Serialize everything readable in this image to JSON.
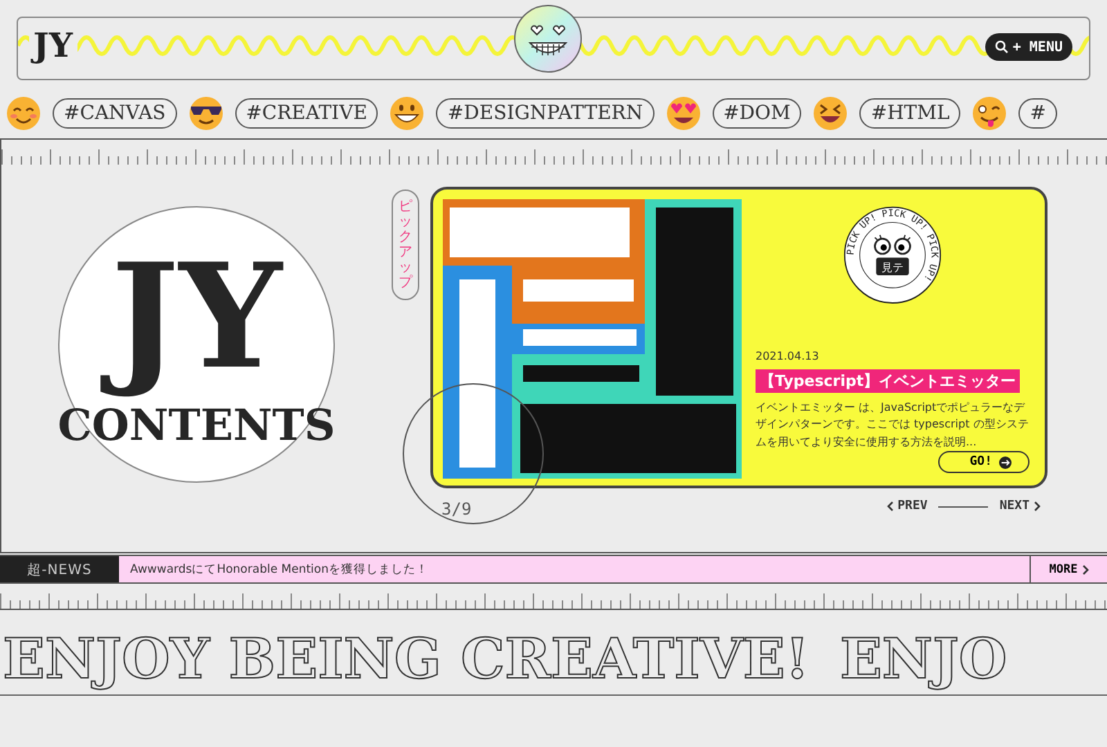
{
  "header": {
    "logo": "JY",
    "menu_button": "+ MENU"
  },
  "tags": [
    "#CANVAS",
    "#CREATIVE",
    "#DESIGNPATTERN",
    "#DOM",
    "#HTML",
    "#"
  ],
  "hero": {
    "logo_title": "JY",
    "logo_subtitle": "CONTENTS",
    "pickup_label": "ピックアップ",
    "badge": {
      "ring_text": "PICK UP! PICK UP! PICK UP!",
      "label": "見テ"
    },
    "article": {
      "date": "2021.04.13",
      "title": "【Typescript】イベントエミッター",
      "excerpt": "イベントエミッター は、JavaScriptでポピュラーなデザインパターンです。ここでは typescript の型システムを用いてより安全に使用する方法を説明...",
      "button": "GO!"
    },
    "counter": "3/9",
    "prev": "PREV",
    "next": "NEXT"
  },
  "news": {
    "label": "超-NEWS",
    "text": "AwwwardsにてHonorable Mentionを獲得しました！",
    "more": "MORE"
  },
  "marquee": [
    "ENJOY BEING CREATIVE!",
    "ENJO"
  ]
}
